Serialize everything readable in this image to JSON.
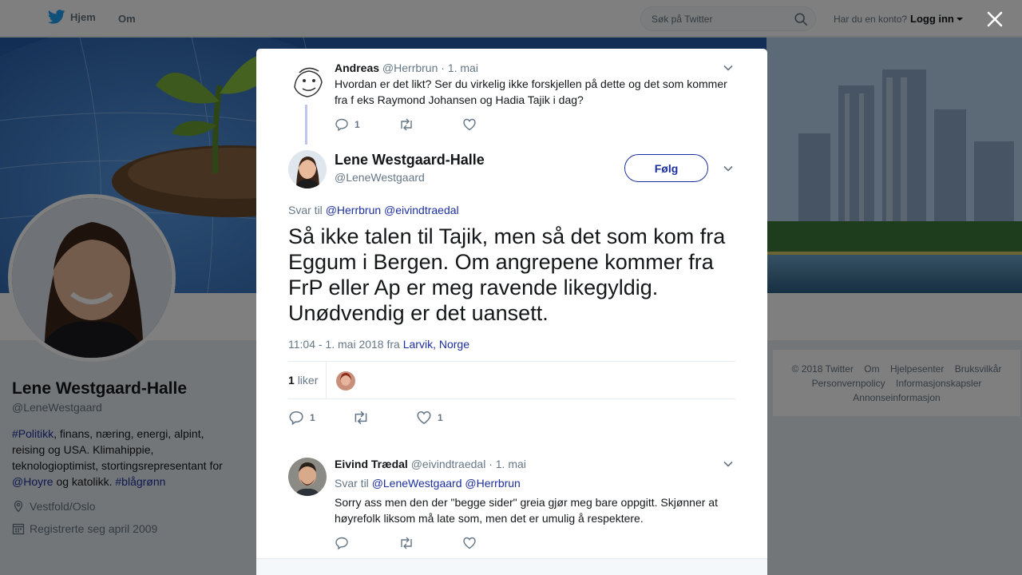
{
  "nav": {
    "home_label": "Hjem",
    "about_label": "Om",
    "search_placeholder": "Søk på Twitter",
    "login_question": "Har du en konto?",
    "login_label": "Logg inn"
  },
  "profile": {
    "name": "Lene Westgaard-Halle",
    "handle": "@LeneWestgaard",
    "bio_hashtag": "#Politikk",
    "bio_text1": ", finans, næring, energi, alpint, reising og USA. Klimahippie, teknologioptimist, stortingsrepresentant for ",
    "bio_mention": "@Hoyre",
    "bio_text2": " og katolikk. ",
    "bio_hashtag2": "#blågrønn",
    "location": "Vestfold/Oslo",
    "joined": "Registrerte seg april 2009"
  },
  "footer": {
    "copyright": "© 2018 Twitter",
    "about": "Om",
    "help": "Hjelpesenter",
    "terms": "Bruksvilkår",
    "privacy": "Personvernpolicy",
    "cookies": "Informasjonskapsler",
    "ads": "Annonseinformasjon"
  },
  "parent_tweet": {
    "name": "Andreas",
    "handle": "@Herrbrun",
    "date": "· 1. mai",
    "text": "Hvordan er det likt? Ser du virkelig ikke forskjellen på dette og det som kommer fra f eks Raymond Johansen og Hadia Tajik i dag?",
    "replies": "1"
  },
  "main_tweet": {
    "name": "Lene Westgaard-Halle",
    "handle": "@LeneWestgaard",
    "follow_label": "Følg",
    "reply_prefix": "Svar til",
    "reply_to_1": "@Herrbrun",
    "reply_to_2": "@eivindtraedal",
    "text": "Så ikke talen til Tajik, men så det som kom fra Eggum i Bergen. Om angrepene kommer fra FrP eller Ap er meg ravende likegyldig. Unødvendig er det uansett.",
    "timestamp": "11:04 - 1. mai 2018 fra",
    "location": "Larvik, Norge",
    "likes_count": "1",
    "likes_label": "liker",
    "replies": "1",
    "likes": "1"
  },
  "reply_tweet": {
    "name": "Eivind Trædal",
    "handle": "@eivindtraedal",
    "date": "· 1. mai",
    "reply_prefix": "Svar til",
    "reply_to_1": "@LeneWestgaard",
    "reply_to_2": "@Herrbrun",
    "text": "Sorry ass men den der \"begge sider\" greia gjør meg bare oppgitt. Skjønner at høyrefolk liksom må late som, men det er umulig å respektere."
  },
  "colors": {
    "link": "#1b2f9e",
    "twitter_blue": "#1da1f2",
    "muted": "#657786"
  }
}
